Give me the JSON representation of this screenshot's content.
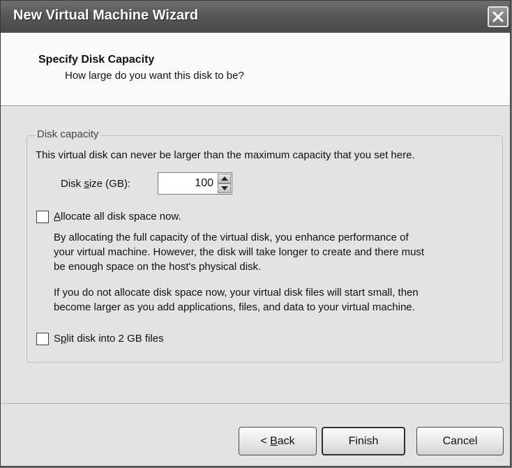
{
  "window": {
    "title": "New Virtual Machine Wizard"
  },
  "header": {
    "title": "Specify Disk Capacity",
    "subtitle": "How large do you want this disk to be?"
  },
  "disk_capacity": {
    "group_label": "Disk capacity",
    "description": "This virtual disk can never be larger than the maximum capacity that you set here.",
    "size_label_pre": "Disk ",
    "size_label_mnemonic": "s",
    "size_label_post": "ize (GB):",
    "size_value": "100",
    "allocate": {
      "checked": false,
      "mnemonic": "A",
      "label_rest": "llocate all disk space now.",
      "desc1_line1": "By allocating the full capacity of the virtual disk, you enhance performance of",
      "desc1_line2": "your virtual machine.  However, the disk will take longer to create and there must",
      "desc1_line3": "be enough space on the host's physical disk.",
      "desc2_line1": "If you do not allocate disk space now, your virtual disk files will start small, then",
      "desc2_line2": "become larger as you add applications, files, and data to your virtual machine."
    },
    "split": {
      "checked": false,
      "label_pre": "S",
      "mnemonic": "p",
      "label_post": "lit disk into 2 GB files"
    }
  },
  "buttons": {
    "back_pre": "< ",
    "back_mnemonic": "B",
    "back_post": "ack",
    "finish": "Finish",
    "cancel": "Cancel"
  }
}
